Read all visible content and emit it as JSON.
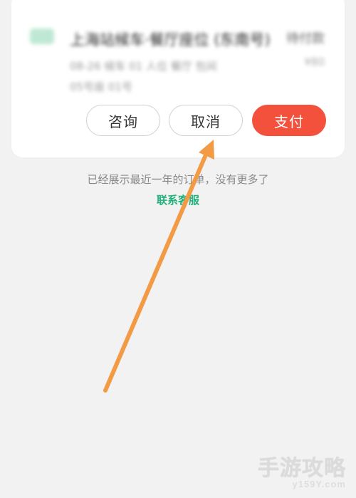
{
  "order": {
    "icon": "service-icon",
    "title": "上海站候车·餐厅座位 (东南号)",
    "status": "待付款",
    "detail": "08-26 候车 01 人位 餐厅 包间",
    "price": "¥80",
    "meta": "05号座 01号",
    "buttons": {
      "consult": "咨询",
      "cancel": "取消",
      "pay": "支付"
    },
    "colors": {
      "pay_button": "#f4513c",
      "icon_bg": "#bfe8d4"
    }
  },
  "footer": {
    "note": "已经展示最近一年的订单，没有更多了",
    "contact": "联系客服",
    "contact_color": "#23b07d"
  },
  "annotation": {
    "arrow_color": "#f39a45",
    "arrow_target": "cancel-button"
  },
  "watermark": {
    "brand": "手游攻略",
    "site": "y159Y.com"
  }
}
